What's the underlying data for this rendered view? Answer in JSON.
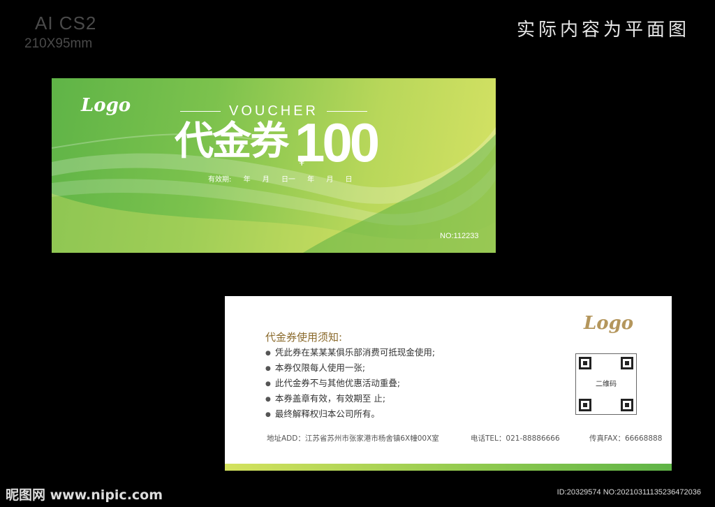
{
  "meta": {
    "software": "AI CS2",
    "size": "210X95mm",
    "note": "实际内容为平面图"
  },
  "front": {
    "logo": "Logo",
    "voucher_en": "VOUCHER",
    "title": "代金券",
    "currency": "¥",
    "amount": "100",
    "validity": [
      "有效期:",
      "年",
      "月",
      "日一",
      "年",
      "月",
      "日"
    ],
    "number": "NO:112233"
  },
  "back": {
    "logo": "Logo",
    "heading": "代金券使用须知:",
    "rules": [
      "凭此券在某某某俱乐部消费可抵现金使用;",
      "本券仅限每人使用一张;",
      "此代金券不与其他优惠活动重叠;",
      "本券盖章有效，有效期至           止;",
      "最终解释权归本公司所有。"
    ],
    "qr_label": "二维码",
    "address": "地址ADD：江苏省苏州市张家港市杨舍镇6X幢00X室",
    "tel": "电话TEL：021-88886666",
    "fax": "传真FAX：66668888"
  },
  "watermark": {
    "site": "昵图网 www.nipic.com",
    "id": "ID:20329574 NO:20210311135236472036"
  },
  "colors": {
    "green_dark": "#5fb447",
    "green_light": "#d6e264",
    "gold": "#b4965c",
    "background": "#000000"
  }
}
